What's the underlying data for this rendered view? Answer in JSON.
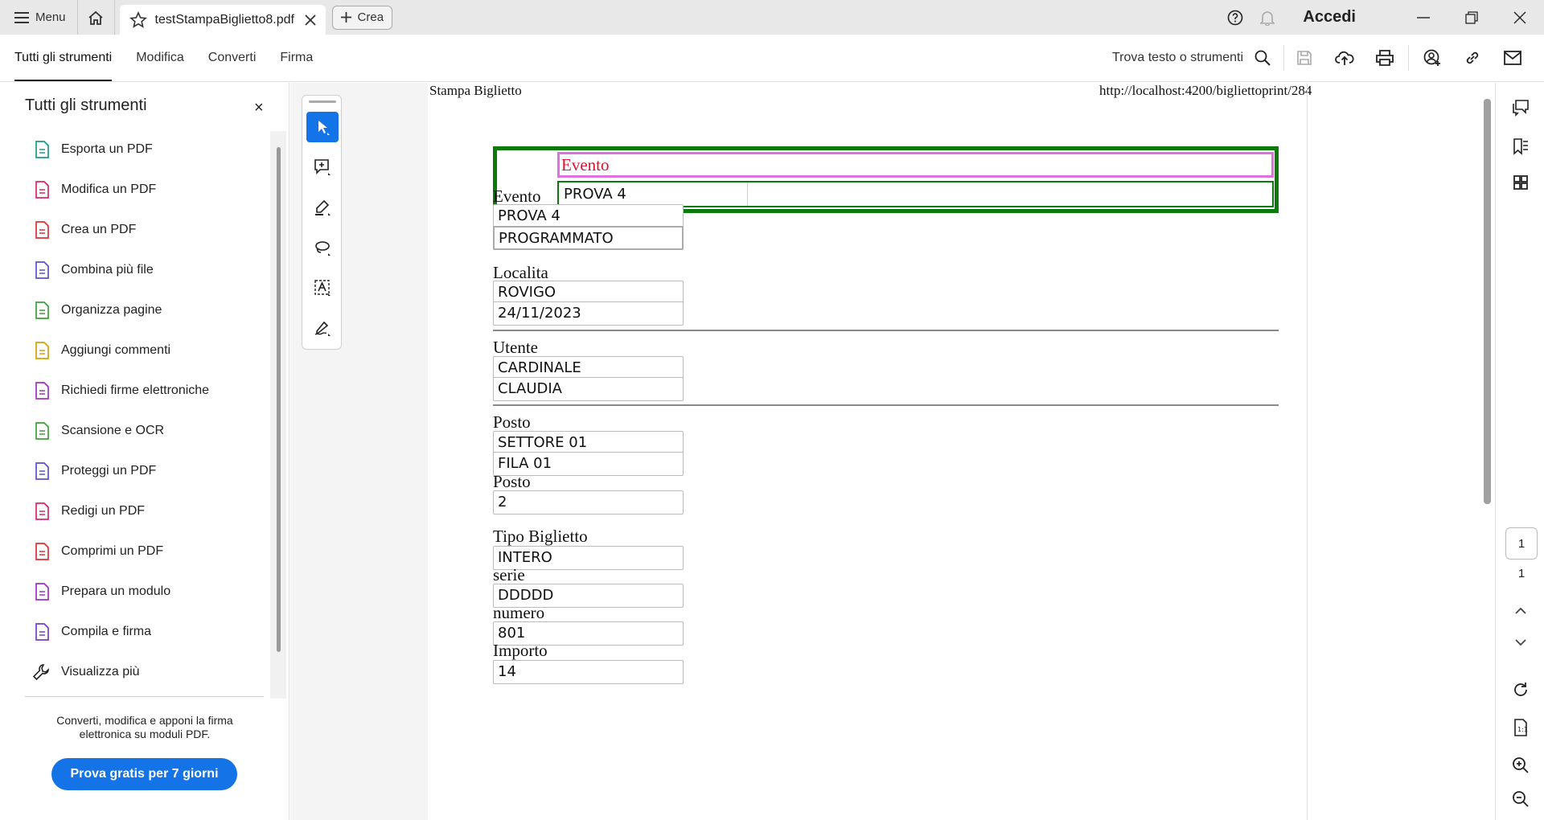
{
  "titlebar": {
    "menu_label": "Menu",
    "tab_title": "testStampaBiglietto8.pdf",
    "crea_label": "Crea",
    "accedi_label": "Accedi"
  },
  "toolbar": {
    "tabs": [
      "Tutti gli strumenti",
      "Modifica",
      "Converti",
      "Firma"
    ],
    "find_label": "Trova testo o strumenti"
  },
  "left_panel": {
    "title": "Tutti gli strumenti",
    "close_glyph": "×",
    "items": [
      {
        "label": "Esporta un PDF",
        "icon": "export-pdf-icon",
        "color": "#1a9a8a"
      },
      {
        "label": "Modifica un PDF",
        "icon": "edit-pdf-icon",
        "color": "#e0245e"
      },
      {
        "label": "Crea un PDF",
        "icon": "create-pdf-icon",
        "color": "#e03030"
      },
      {
        "label": "Combina più file",
        "icon": "combine-files-icon",
        "color": "#5a4fd8"
      },
      {
        "label": "Organizza pagine",
        "icon": "organize-pages-icon",
        "color": "#3aa03a"
      },
      {
        "label": "Aggiungi commenti",
        "icon": "add-comment-icon",
        "color": "#d8a000"
      },
      {
        "label": "Richiedi firme elettroniche",
        "icon": "request-signatures-icon",
        "color": "#a030c0"
      },
      {
        "label": "Scansione e OCR",
        "icon": "scan-ocr-icon",
        "color": "#3aa03a"
      },
      {
        "label": "Proteggi un PDF",
        "icon": "protect-pdf-icon",
        "color": "#5a4fd8"
      },
      {
        "label": "Redigi un PDF",
        "icon": "redact-pdf-icon",
        "color": "#e0245e"
      },
      {
        "label": "Comprimi un PDF",
        "icon": "compress-pdf-icon",
        "color": "#e03030"
      },
      {
        "label": "Prepara un modulo",
        "icon": "prepare-form-icon",
        "color": "#a030c0"
      },
      {
        "label": "Compila e firma",
        "icon": "fill-sign-icon",
        "color": "#7a3ad0"
      }
    ],
    "more_label": "Visualizza più",
    "promo_text": "Converti, modifica e apponi la firma elettronica su moduli PDF.",
    "cta_label": "Prova gratis per 7 giorni",
    "accent": "#1473e6"
  },
  "document": {
    "header_left": "Stampa Biglietto",
    "header_right": "http://localhost:4200/bigliettoprint/284",
    "top_box": {
      "label": "Evento",
      "value": "PROVA 4"
    },
    "fields": {
      "evento_label": "Evento",
      "evento_value": "PROVA 4",
      "stato_value": "PROGRAMMATO",
      "localita_label": "Localita",
      "localita_value": "ROVIGO",
      "data_value": "24/11/2023",
      "utente_label": "Utente",
      "cognome_value": "CARDINALE",
      "nome_value": "CLAUDIA",
      "posto_label": "Posto",
      "settore_value": "SETTORE 01",
      "fila_value": "FILA 01",
      "posto_label2": "Posto",
      "posto_value": "2",
      "tipo_label": "Tipo Biglietto",
      "tipo_value": "INTERO",
      "serie_label": "serie",
      "serie_value": "DDDDD",
      "numero_label": "numero",
      "numero_value": "801",
      "importo_label": "Importo",
      "importo_value": "14"
    }
  },
  "right_rail": {
    "current_page": "1",
    "total_pages": "1"
  }
}
